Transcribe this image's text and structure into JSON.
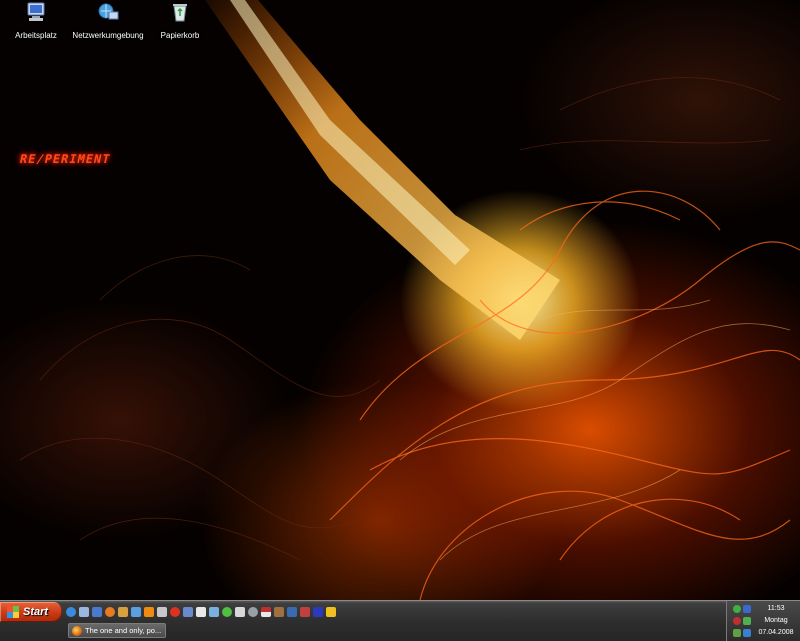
{
  "desktop": {
    "icons": [
      {
        "label": "Arbeitsplatz",
        "icon": "my-computer-icon"
      },
      {
        "label": "Netzwerkumgebung",
        "icon": "network-places-icon"
      },
      {
        "label": "Papierkorb",
        "icon": "recycle-bin-icon"
      }
    ],
    "wallpaper_logo": "RE/PERIMENT"
  },
  "taskbar": {
    "start_label": "Start",
    "quick_launch": [
      "ie-icon",
      "show-desktop-icon",
      "media-player-icon",
      "firefox-icon",
      "app-icon",
      "app-icon",
      "vlc-icon",
      "app-icon",
      "app-icon",
      "app-icon",
      "app-icon",
      "app-icon",
      "app-icon",
      "app-icon",
      "steam-icon",
      "flag-icon",
      "app-icon",
      "app-icon",
      "app-icon",
      "app-icon",
      "app-icon"
    ],
    "windows": [
      {
        "label": "The one and only, po...",
        "icon": "firefox-icon"
      }
    ],
    "tray": {
      "time": "11:53",
      "day": "Montag",
      "date": "07.04.2008"
    }
  },
  "colors": {
    "start_button": "#c93a16",
    "taskbar": "#2e2e2e",
    "fire_accent": "#ff5a00"
  }
}
